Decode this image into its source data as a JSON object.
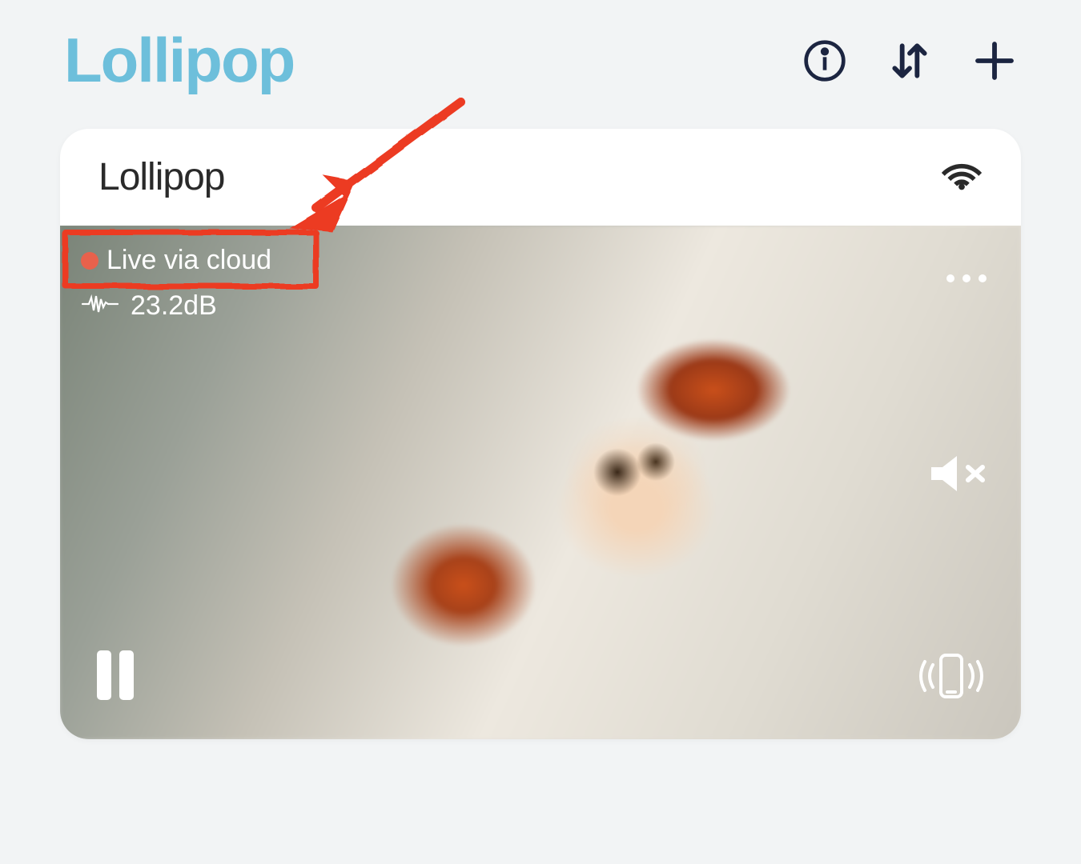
{
  "header": {
    "logo": "Lollipop"
  },
  "card": {
    "title": "Lollipop"
  },
  "video": {
    "live_status": "Live via cloud",
    "decibel_value": "23.2dB"
  },
  "colors": {
    "logo": "#6dbfdb",
    "icon_dark": "#1c2541",
    "live_dot": "#e8614c",
    "annotation": "#ec3a24"
  }
}
